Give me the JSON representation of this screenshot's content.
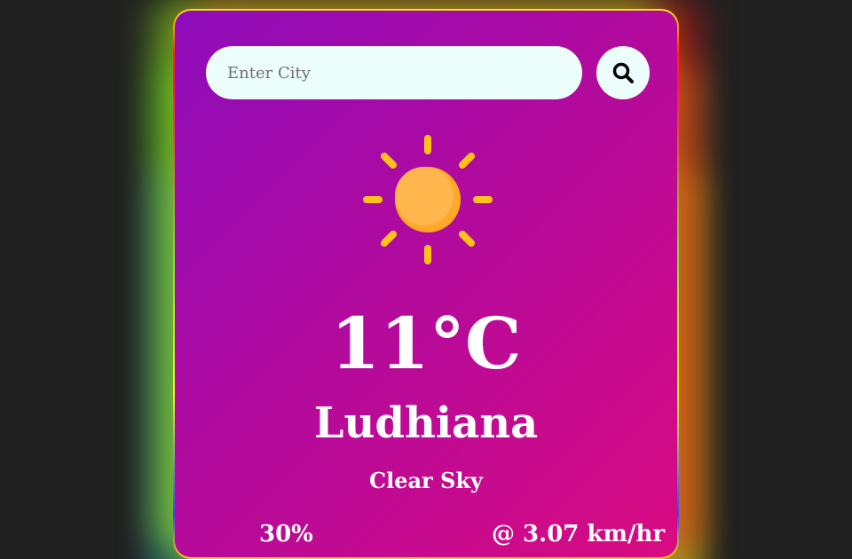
{
  "search": {
    "placeholder": "Enter City",
    "value": "",
    "button_icon": "search-icon"
  },
  "weather": {
    "icon": "sun-icon",
    "temperature": "11°C",
    "city": "Ludhiana",
    "description": "Clear Sky",
    "humidity": "30%",
    "wind_speed": "@ 3.07 km/hr"
  },
  "colors": {
    "page_background": "#212121",
    "card_gradient_start": "#8e0cbb",
    "card_gradient_end": "#d90b80",
    "input_background": "#ecfefb",
    "sun_rays": "#ffc21a",
    "sun_core": "#ffb03b",
    "text": "#ffffff"
  }
}
